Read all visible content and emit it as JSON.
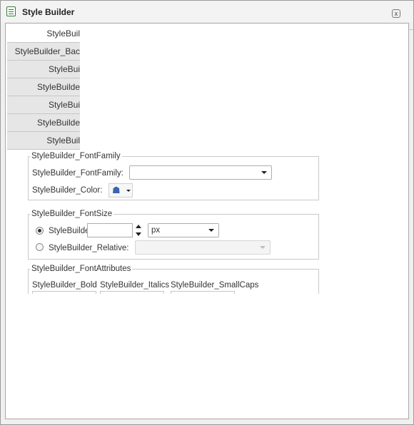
{
  "window": {
    "title": "Style Builder",
    "close_label": "x"
  },
  "tabs": [
    {
      "label": "StyleBuil"
    },
    {
      "label": "StyleBuilder_Bac"
    },
    {
      "label": "StyleBui"
    },
    {
      "label": "StyleBuilde"
    },
    {
      "label": "StyleBui"
    },
    {
      "label": "StyleBuilde"
    },
    {
      "label": "StyleBuil"
    }
  ],
  "font_family_group": {
    "legend": "StyleBuilder_FontFamily",
    "font_family_label": "StyleBuilder_FontFamily:",
    "font_family_value": "",
    "color_label": "StyleBuilder_Color:",
    "color_icon": "paint-bucket-icon"
  },
  "font_size_group": {
    "legend": "StyleBuilder_FontSize",
    "absolute_label": "StyleBuilde",
    "absolute_value": "",
    "unit_value": "px",
    "absolute_selected": true,
    "relative_label": "StyleBuilder_Relative:",
    "relative_value": ""
  },
  "font_attributes_group": {
    "legend": "StyleBuilder_FontAttributes",
    "bold_label": "StyleBuilder_Bold",
    "italics_label": "StyleBuilder_Italics",
    "smallcaps_label": "StyleBuilder_SmallCaps"
  }
}
